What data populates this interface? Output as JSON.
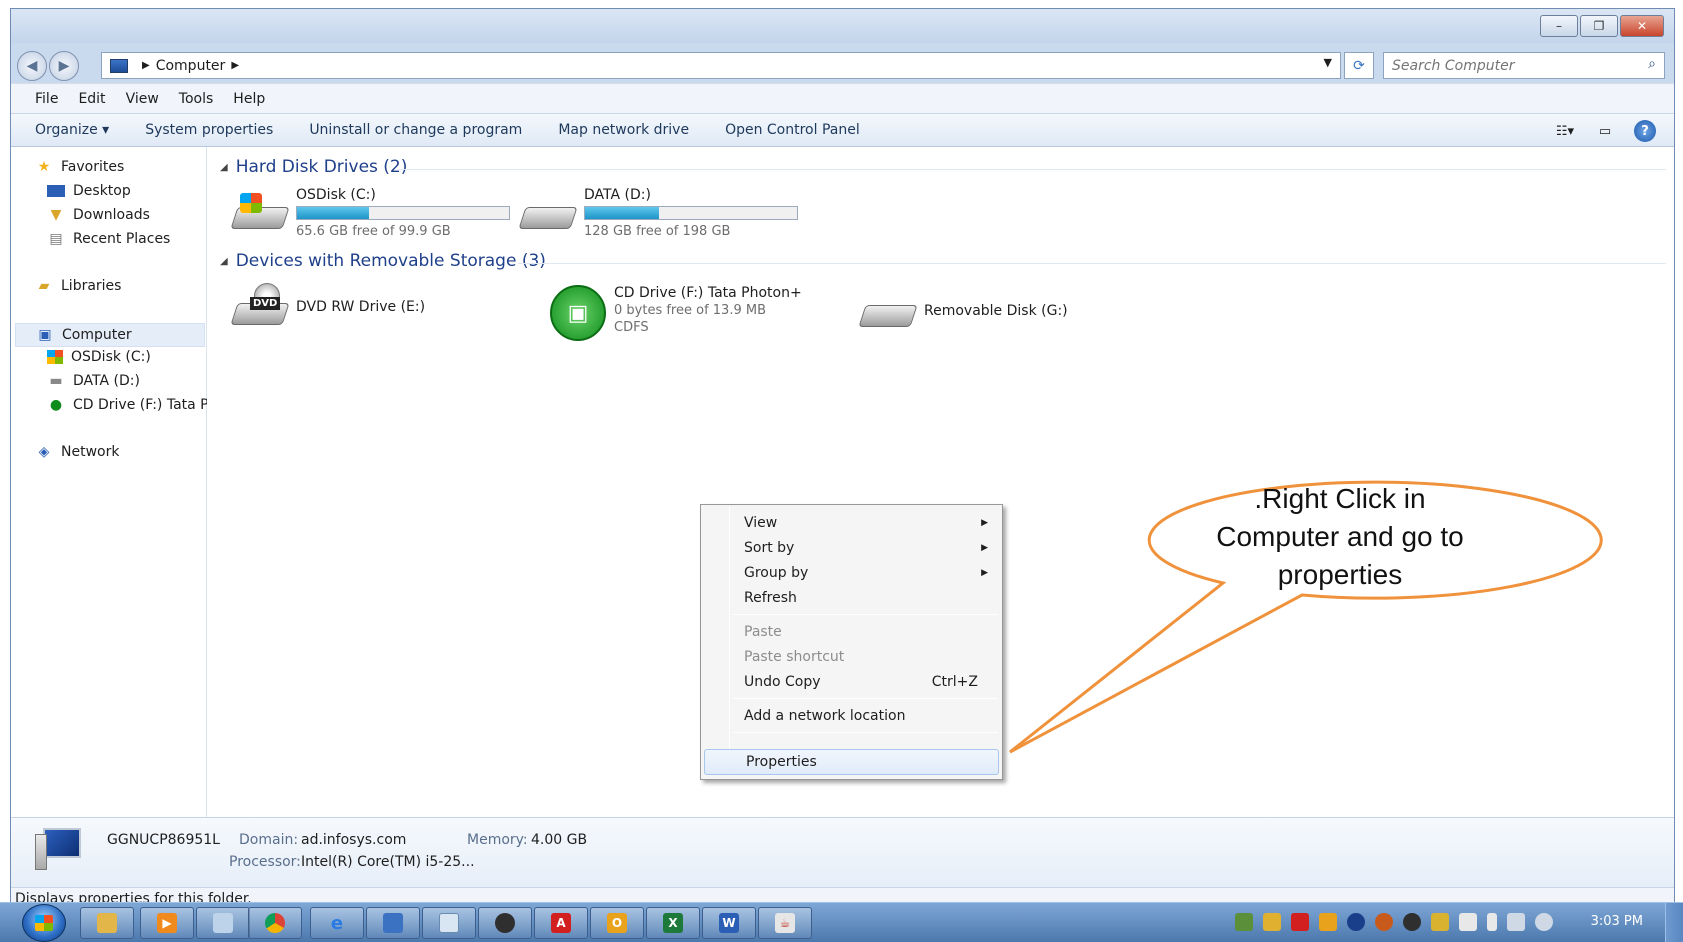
{
  "window": {
    "controls": {
      "minimize": "–",
      "maximize": "❐",
      "close": "✕"
    }
  },
  "address": {
    "crumb": "Computer",
    "search_placeholder": "Search Computer"
  },
  "menu": [
    "File",
    "Edit",
    "View",
    "Tools",
    "Help"
  ],
  "commands": {
    "organize": "Organize ▾",
    "items": [
      "System properties",
      "Uninstall or change a program",
      "Map network drive",
      "Open Control Panel"
    ]
  },
  "nav": {
    "favorites": "Favorites",
    "desktop": "Desktop",
    "downloads": "Downloads",
    "recent": "Recent Places",
    "libraries": "Libraries",
    "computer": "Computer",
    "osdisk": "OSDisk (C:)",
    "data": "DATA (D:)",
    "cddrive": "CD Drive (F:) Tata Ph",
    "network": "Network"
  },
  "groups": {
    "hdd": "Hard Disk Drives (2)",
    "removable": "Devices with Removable Storage (3)"
  },
  "drives": {
    "c": {
      "name": "OSDisk (C:)",
      "free": "65.6 GB free of 99.9 GB",
      "used_fraction": 0.34
    },
    "d": {
      "name": "DATA (D:)",
      "free": "128 GB free of 198 GB",
      "used_fraction": 0.35
    },
    "e": {
      "name": "DVD RW Drive (E:)",
      "badge": "DVD"
    },
    "f": {
      "name": "CD Drive (F:) Tata Photon+",
      "free": "0 bytes free of 13.9 MB",
      "fs": "CDFS"
    },
    "g": {
      "name": "Removable Disk (G:)"
    }
  },
  "details": {
    "computer_name": "GGNUCP86951L",
    "domain_label": "Domain:",
    "domain_value": "ad.infosys.com",
    "memory_label": "Memory:",
    "memory_value": "4.00 GB",
    "processor_label": "Processor:",
    "processor_value": "Intel(R) Core(TM) i5-25..."
  },
  "status": "Displays properties for this folder.",
  "context_menu": {
    "view": "View",
    "sort_by": "Sort by",
    "group_by": "Group by",
    "refresh": "Refresh",
    "paste": "Paste",
    "paste_shortcut": "Paste shortcut",
    "undo_copy": "Undo Copy",
    "undo_shortcut": "Ctrl+Z",
    "add_network": "Add a network location",
    "properties": "Properties"
  },
  "callout": {
    "line1": ".Right Click in",
    "line2": "Computer and go to",
    "line3": "properties",
    "stroke": "#f0923b"
  },
  "taskbar": {
    "clock": "3:03 PM"
  }
}
